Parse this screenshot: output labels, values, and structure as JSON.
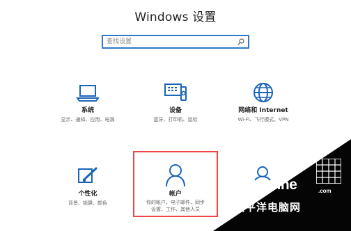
{
  "app": {
    "title": "Windows 设置"
  },
  "search": {
    "placeholder": "查找设置"
  },
  "tiles": {
    "system": {
      "label": "系统",
      "desc": "显示、通知、应用、电源",
      "icon": "laptop-icon"
    },
    "devices": {
      "label": "设备",
      "desc": "蓝牙、打印机、鼠标",
      "icon": "devices-icon"
    },
    "network": {
      "label": "网络和 Internet",
      "desc": "Wi-Fi、飞行模式、VPN",
      "icon": "globe-icon"
    },
    "personalization": {
      "label": "个性化",
      "desc": "背景、锁屏、颜色",
      "icon": "personalization-icon"
    },
    "accounts": {
      "label": "帐户",
      "desc_line1": "你的帐户、电子邮件、同步",
      "desc_line2": "设置、工作、其他人员",
      "icon": "account-icon"
    }
  },
  "watermark": {
    "brand": "PConline",
    "suffix": ".com",
    "cn": "太平洋电脑网"
  },
  "colors": {
    "accent": "#2f77c8",
    "highlight": "#f04545",
    "text": "#222222",
    "muted": "#666666"
  }
}
